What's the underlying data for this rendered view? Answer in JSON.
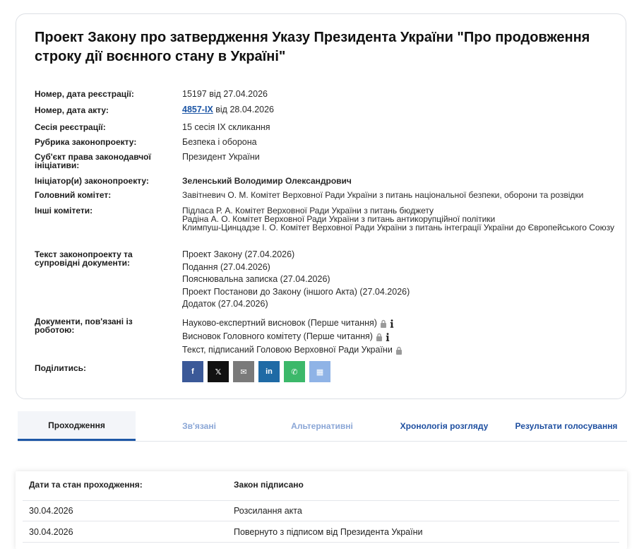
{
  "bill": {
    "title": "Проект Закону про затвердження Указу Президента України \"Про продовження строку дії воєнного стану в Україні\"",
    "fields": {
      "reg_label": "Номер, дата реєстрації:",
      "reg_value": "15197 від 27.04.2026",
      "act_label": "Номер, дата акту:",
      "act_number": "4857-IX",
      "act_date": "від 28.04.2026",
      "session_label": "Сесія реєстрації:",
      "session_value": "15 сесія IX скликання",
      "rubric_label": "Рубрика законопроекту:",
      "rubric_value": "Безпека і оборона",
      "subject_label": "Суб'єкт права законодавчої ініціативи:",
      "subject_value": "Президент України",
      "initiator_label": "Ініціатор(и) законопроекту:",
      "initiator_value": "Зеленський Володимир Олександрович",
      "main_committee_label": "Головний комітет:",
      "main_committee_value": "Завітневич О. М. Комітет Верховної Ради України з питань національної безпеки, оборони та розвідки",
      "other_committees_label": "Інші комітети:",
      "other_committees": [
        "Підласа Р. А. Комітет Верховної Ради України з питань бюджету",
        "Радіна А. О. Комітет Верховної Ради України з питань антикорупційної політики",
        "Климпуш-Цинцадзе І. О. Комітет Верховної Ради України з питань інтеграції України до Європейського Союзу"
      ],
      "docs_label": "Текст законопроекту та супровідні документи:",
      "docs": [
        "Проект Закону (27.04.2026)",
        "Подання (27.04.2026)",
        "Пояснювальна записка (27.04.2026)",
        "Проект Постанови до Закону (іншого Акта) (27.04.2026)",
        "Додаток (27.04.2026)"
      ],
      "related_docs_label": "Документи, пов'язані із роботою:",
      "related_docs": [
        "Науково-експертний висновок (Перше читання)",
        "Висновок Головного комітету (Перше читання)",
        "Текст, підписаний Головою Верховної Ради України"
      ],
      "share_label": "Поділитись:"
    },
    "share_buttons": [
      {
        "icon": "facebook-icon",
        "glyph": "f",
        "color": "#3b5998"
      },
      {
        "icon": "x-icon",
        "glyph": "𝕏",
        "color": "#111111"
      },
      {
        "icon": "email-icon",
        "glyph": "✉",
        "color": "#7a7a7a"
      },
      {
        "icon": "linkedin-icon",
        "glyph": "in",
        "color": "#1f6aa5"
      },
      {
        "icon": "whatsapp-icon",
        "glyph": "✆",
        "color": "#3cb86a"
      },
      {
        "icon": "qr-icon",
        "glyph": "▦",
        "color": "#8fb3e6"
      }
    ]
  },
  "tabs": [
    {
      "label": "Проходження",
      "color": "#1f1f1f"
    },
    {
      "label": "Зв'язані",
      "color": "#8aa6d6"
    },
    {
      "label": "Альтернативні",
      "color": "#8aa6d6"
    },
    {
      "label": "Хронологія розгляду",
      "color": "#1e4fa0"
    },
    {
      "label": "Результати голосування",
      "color": "#1e4fa0"
    }
  ],
  "passage": {
    "header_col1": "Дати та стан проходження:",
    "header_col2": "Закон підписано",
    "rows": [
      {
        "date": "30.04.2026",
        "status": "Розсилання акта"
      },
      {
        "date": "30.04.2026",
        "status": "Повернуто з підписом від Президента України"
      }
    ]
  }
}
